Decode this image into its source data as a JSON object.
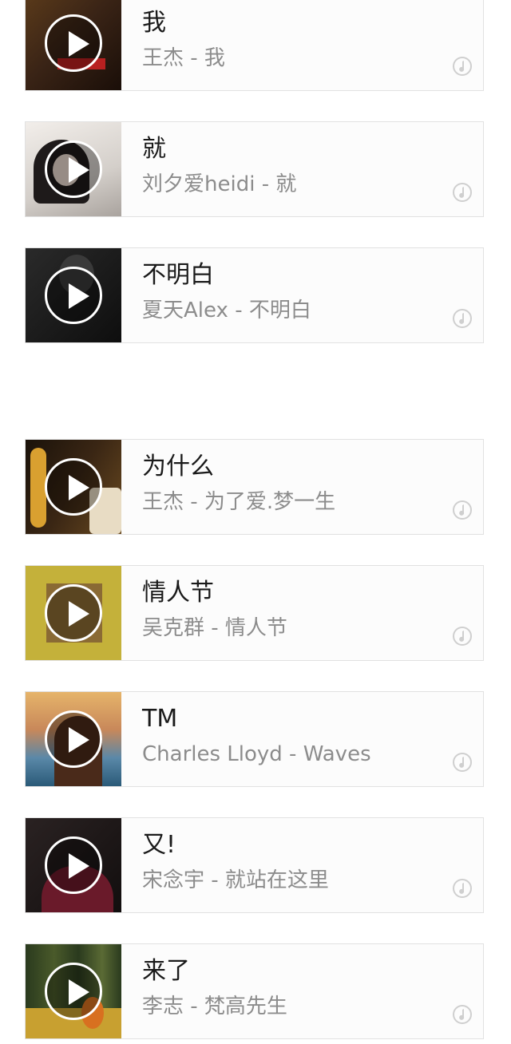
{
  "songs": [
    {
      "title": "我",
      "subtitle": "王杰 - 我",
      "cover_color": "#3a2416",
      "cover_accent": "#7a5a2a"
    },
    {
      "title": "就",
      "subtitle": "刘夕爱heidi - 就",
      "cover_color": "#d9d4d0",
      "cover_accent": "#2a2a2a"
    },
    {
      "title": "不明白",
      "subtitle": "夏天Alex - 不明白",
      "cover_color": "#141414",
      "cover_accent": "#4a4a4a"
    },
    {
      "title": "为什么",
      "subtitle": "王杰 - 为了爱.梦一生",
      "cover_color": "#2b1e12",
      "cover_accent": "#c8902a"
    },
    {
      "title": "情人节",
      "subtitle": "吴克群 - 情人节",
      "cover_color": "#c4b13a",
      "cover_accent": "#5a3a20"
    },
    {
      "title": "TM",
      "subtitle": "Charles Lloyd - Waves",
      "cover_color": "#d8a35a",
      "cover_accent": "#3a7aa0"
    },
    {
      "title": "又!",
      "subtitle": "宋念宇 - 就站在这里",
      "cover_color": "#1c1616",
      "cover_accent": "#7a2030"
    },
    {
      "title": "来了",
      "subtitle": "李志 - 梵高先生",
      "cover_color": "#3a4a2a",
      "cover_accent": "#d9b040"
    }
  ]
}
